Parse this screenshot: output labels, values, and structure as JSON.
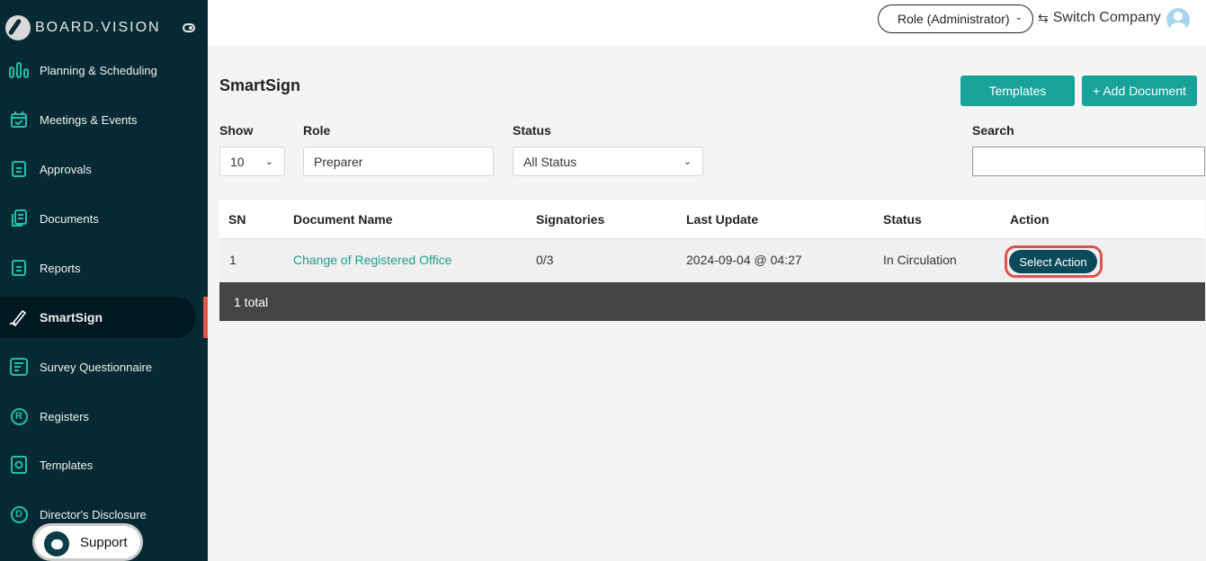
{
  "brand": {
    "name": "BOARD.VISION"
  },
  "sidebar": {
    "items": [
      {
        "label": "Planning & Scheduling",
        "icon": "bar-chart-icon"
      },
      {
        "label": "Meetings & Events",
        "icon": "calendar-icon"
      },
      {
        "label": "Approvals",
        "icon": "approval-doc-icon"
      },
      {
        "label": "Documents",
        "icon": "documents-icon"
      },
      {
        "label": "Reports",
        "icon": "reports-icon"
      },
      {
        "label": "SmartSign",
        "icon": "pen-sign-icon",
        "active": true
      },
      {
        "label": "Survey Questionnaire",
        "icon": "survey-icon"
      },
      {
        "label": "Registers",
        "icon": "registers-icon",
        "glyph": "R"
      },
      {
        "label": "Templates",
        "icon": "templates-icon"
      },
      {
        "label": "Director's Disclosure",
        "icon": "disclosure-icon",
        "glyph": "D"
      }
    ],
    "support_label": "Support"
  },
  "topbar": {
    "role_label": "Role (Administrator)",
    "switch_label": "Switch Company"
  },
  "page": {
    "title": "SmartSign",
    "templates_button": "Templates",
    "add_button": "+ Add Document"
  },
  "filters": {
    "show_label": "Show",
    "show_value": "10",
    "role_label": "Role",
    "role_value": "Preparer",
    "status_label": "Status",
    "status_value": "All Status",
    "search_label": "Search",
    "search_value": ""
  },
  "table": {
    "headers": [
      "SN",
      "Document Name",
      "Signatories",
      "Last Update",
      "Status",
      "Action"
    ],
    "rows": [
      {
        "sn": "1",
        "name": "Change of Registered Office",
        "signatories": "0/3",
        "last_update": "2024-09-04 @ 04:27",
        "status": "In Circulation",
        "action": "Select Action"
      }
    ],
    "footer": "1 total"
  },
  "colors": {
    "sidebar_bg": "#062a33",
    "accent_teal": "#17a29a",
    "action_button": "#0b4a5a",
    "highlight_ring": "#d9534f",
    "active_marker": "#e2574c"
  }
}
